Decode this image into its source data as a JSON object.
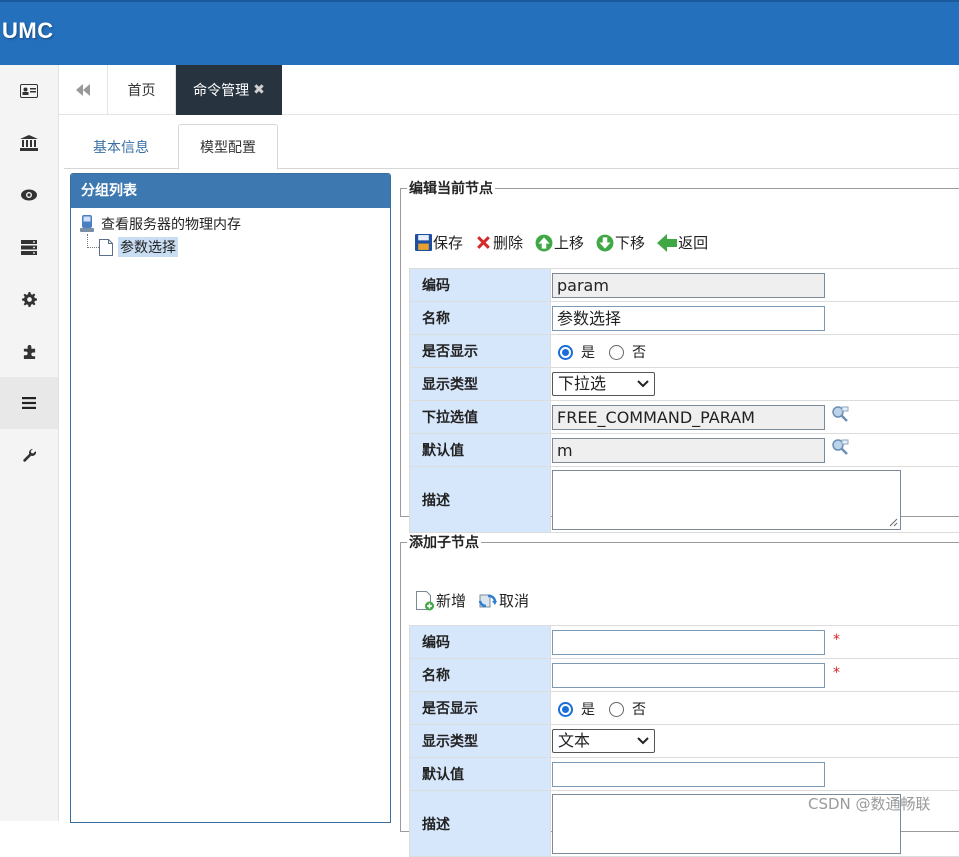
{
  "app": {
    "title": "UMC"
  },
  "sidebar": {
    "icons": [
      "id-card-icon",
      "bank-icon",
      "eye-icon",
      "server-icon",
      "gear-icon",
      "puzzle-icon",
      "list-icon",
      "wrench-icon"
    ]
  },
  "tabs": {
    "home_label": "首页",
    "command_label": "命令管理",
    "close_glyph": "✖"
  },
  "subtabs": {
    "basic": "基本信息",
    "model": "模型配置"
  },
  "group_panel": {
    "title": "分组列表",
    "root": "查看服务器的物理内存",
    "child": "参数选择"
  },
  "edit_node": {
    "legend": "编辑当前节点",
    "toolbar": {
      "save": "保存",
      "delete": "删除",
      "up": "上移",
      "down": "下移",
      "back": "返回"
    },
    "fields": {
      "code_label": "编码",
      "code_value": "param",
      "name_label": "名称",
      "name_value": "参数选择",
      "show_label": "是否显示",
      "yes": "是",
      "no": "否",
      "show_selected": "是",
      "type_label": "显示类型",
      "type_value": "下拉选",
      "dropdown_label": "下拉选值",
      "dropdown_value": "FREE_COMMAND_PARAM",
      "default_label": "默认值",
      "default_value": "m",
      "desc_label": "描述",
      "desc_value": ""
    }
  },
  "add_node": {
    "legend": "添加子节点",
    "toolbar": {
      "add": "新增",
      "cancel": "取消"
    },
    "fields": {
      "code_label": "编码",
      "code_value": "",
      "name_label": "名称",
      "name_value": "",
      "required_mark": "*",
      "show_label": "是否显示",
      "yes": "是",
      "no": "否",
      "show_selected": "是",
      "type_label": "显示类型",
      "type_value": "文本",
      "default_label": "默认值",
      "default_value": "",
      "desc_label": "描述"
    }
  },
  "watermark": "CSDN @数通畅联",
  "colors": {
    "header": "#2470bd",
    "active_tab": "#27333f",
    "label_bg": "#d7e7fb",
    "panel_head": "#3d78b0"
  }
}
